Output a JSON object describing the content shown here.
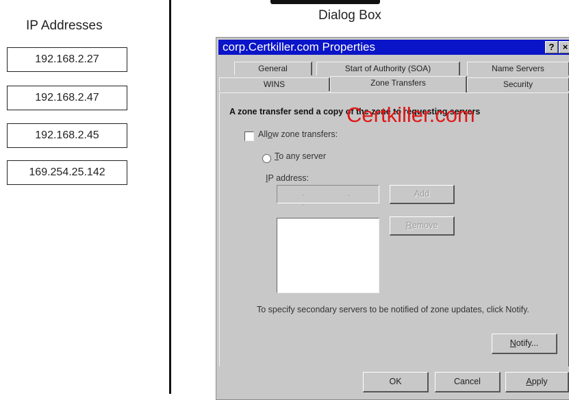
{
  "left_panel": {
    "heading": "IP Addresses",
    "addresses": [
      "192.168.2.27",
      "192.168.2.47",
      "192.168.2.45",
      "169.254.25.142"
    ]
  },
  "right_panel": {
    "heading": "Dialog Box"
  },
  "dialog": {
    "title": "corp.Certkiller.com Properties",
    "title_bar_buttons": [
      "?",
      "×"
    ],
    "tabs_back_row": [
      "General",
      "Start of Authority (SOA)",
      "Name Servers"
    ],
    "tabs_front_row": [
      "WINS",
      "Zone Transfers",
      "Security"
    ],
    "active_tab": "Zone Transfers",
    "description": "A zone transfer send a copy of the zone to requesting servers",
    "watermark": "Certkiller.com",
    "allow_checkbox": {
      "label_pre": "All",
      "label_key": "o",
      "label_post": "w zone transfers:",
      "checked": false
    },
    "radio_any_server": {
      "label_key": "T",
      "label_post": "o any server",
      "selected": false
    },
    "ip_address_label": {
      "key": "I",
      "post": "P address:"
    },
    "ip_placeholder_dots": ". . .",
    "buttons": {
      "add": "Add",
      "remove_key": "R",
      "remove_post": "emove",
      "notify_key": "N",
      "notify_post": "otify...",
      "ok": "OK",
      "cancel": "Cancel",
      "apply_key": "A",
      "apply_post": "pply"
    },
    "help_text": "To specify secondary servers to be notified of zone updates, click Notify."
  }
}
